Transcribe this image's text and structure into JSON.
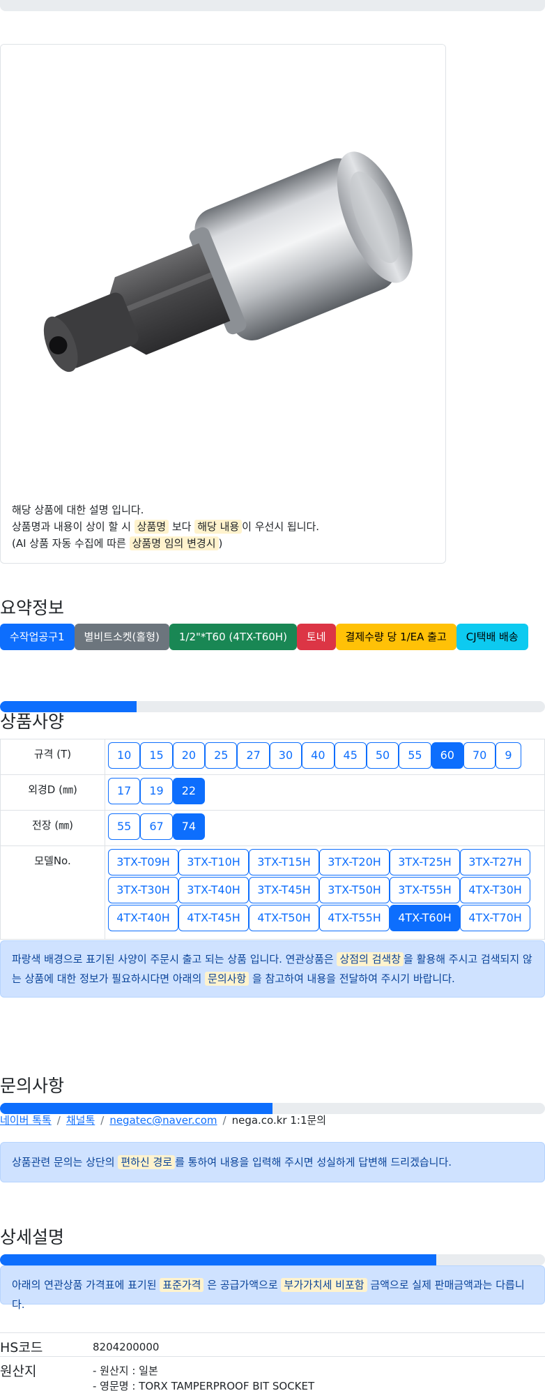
{
  "product": {
    "description_line1": "해당 상품에 대한 설명 입니다.",
    "description_line2_a": "상품명과 내용이 상이 할 시 ",
    "description_line2_hl1": "상품명",
    "description_line2_b": " 보다 ",
    "description_line2_hl2": "해당 내용",
    "description_line2_c": "이 우선시 됩니다.",
    "description_line3_a": "(AI 상품 자동 수집에 따른 ",
    "description_line3_hl": "상품명 임의 변경시",
    "description_line3_b": ")"
  },
  "summary": {
    "title": "요약정보",
    "badges": [
      {
        "label": "수작업공구1",
        "bg": "#0d6efd",
        "fg": "#ffffff"
      },
      {
        "label": "별비트소켓(홀형)",
        "bg": "#6c757d",
        "fg": "#ffffff"
      },
      {
        "label": "1/2\"*T60 (4TX-T60H)",
        "bg": "#198754",
        "fg": "#ffffff"
      },
      {
        "label": "토네",
        "bg": "#dc3545",
        "fg": "#ffffff"
      },
      {
        "label": "결제수량 당 1/EA 출고",
        "bg": "#ffc107",
        "fg": "#000000"
      },
      {
        "label": "CJ택배 배송",
        "bg": "#0dcaf0",
        "fg": "#000000"
      }
    ]
  },
  "spec": {
    "title": "상품사양",
    "progress": 0.25,
    "rows": [
      {
        "label": "규격 (T)",
        "values": [
          "10",
          "15",
          "20",
          "25",
          "27",
          "30",
          "40",
          "45",
          "50",
          "55",
          "60",
          "70",
          "9"
        ],
        "selected": "60"
      },
      {
        "label": "외경D (㎜)",
        "values": [
          "17",
          "19",
          "22"
        ],
        "selected": "22"
      },
      {
        "label": "전장 (㎜)",
        "values": [
          "55",
          "67",
          "74"
        ],
        "selected": "74"
      },
      {
        "label": "모델No.",
        "values": [
          "3TX-T09H",
          "3TX-T10H",
          "3TX-T15H",
          "3TX-T20H",
          "3TX-T25H",
          "3TX-T27H",
          "3TX-T30H",
          "3TX-T40H",
          "3TX-T45H",
          "3TX-T50H",
          "3TX-T55H",
          "4TX-T30H",
          "4TX-T40H",
          "4TX-T45H",
          "4TX-T50H",
          "4TX-T55H",
          "4TX-T60H",
          "4TX-T70H"
        ],
        "selected": "4TX-T60H"
      }
    ],
    "notice_a": "파랑색 배경으로 표기된 사양이 주문시 출고 되는 상품 입니다. 연관상품은 ",
    "notice_hl1": "상점의 검색창",
    "notice_b": "을 활용해 주시고 검색되지 않",
    "notice_c": "는 상품에 대한 정보가 필요하시다면 아래의 ",
    "notice_hl2": "문의사항",
    "notice_d": " 을 참고하여 내용을 전달하여 주시기 바랍니다."
  },
  "inquiry": {
    "title": "문의사항",
    "progress": 0.5,
    "links": [
      "네이버 톡톡",
      "채널톡",
      "negatec@naver.com"
    ],
    "plain": "nega.co.kr 1:1문의",
    "separator": "/",
    "notice_a": "상품관련 문의는 상단의 ",
    "notice_hl": "편하신 경로",
    "notice_b": "를 통하여 내용을 입력해 주시면 성실하게 답변해 드리겠습니다."
  },
  "detail": {
    "title": "상세설명",
    "progress": 0.8,
    "notice_a": "아래의 연관상품 가격표에 표기된 ",
    "notice_hl1": "표준가격",
    "notice_b": " 은 공급가액으로 ",
    "notice_hl2": "부가가치세 비포함",
    "notice_c": " 금액으로 실제 판매금액과는 다릅니다.",
    "info": [
      {
        "key": "HS코드",
        "lines": [
          "8204200000"
        ]
      },
      {
        "key": "원산지",
        "lines": [
          "- 원산지 : 일본",
          "- 영문명 : TORX TAMPERPROOF BIT SOCKET"
        ]
      }
    ]
  }
}
